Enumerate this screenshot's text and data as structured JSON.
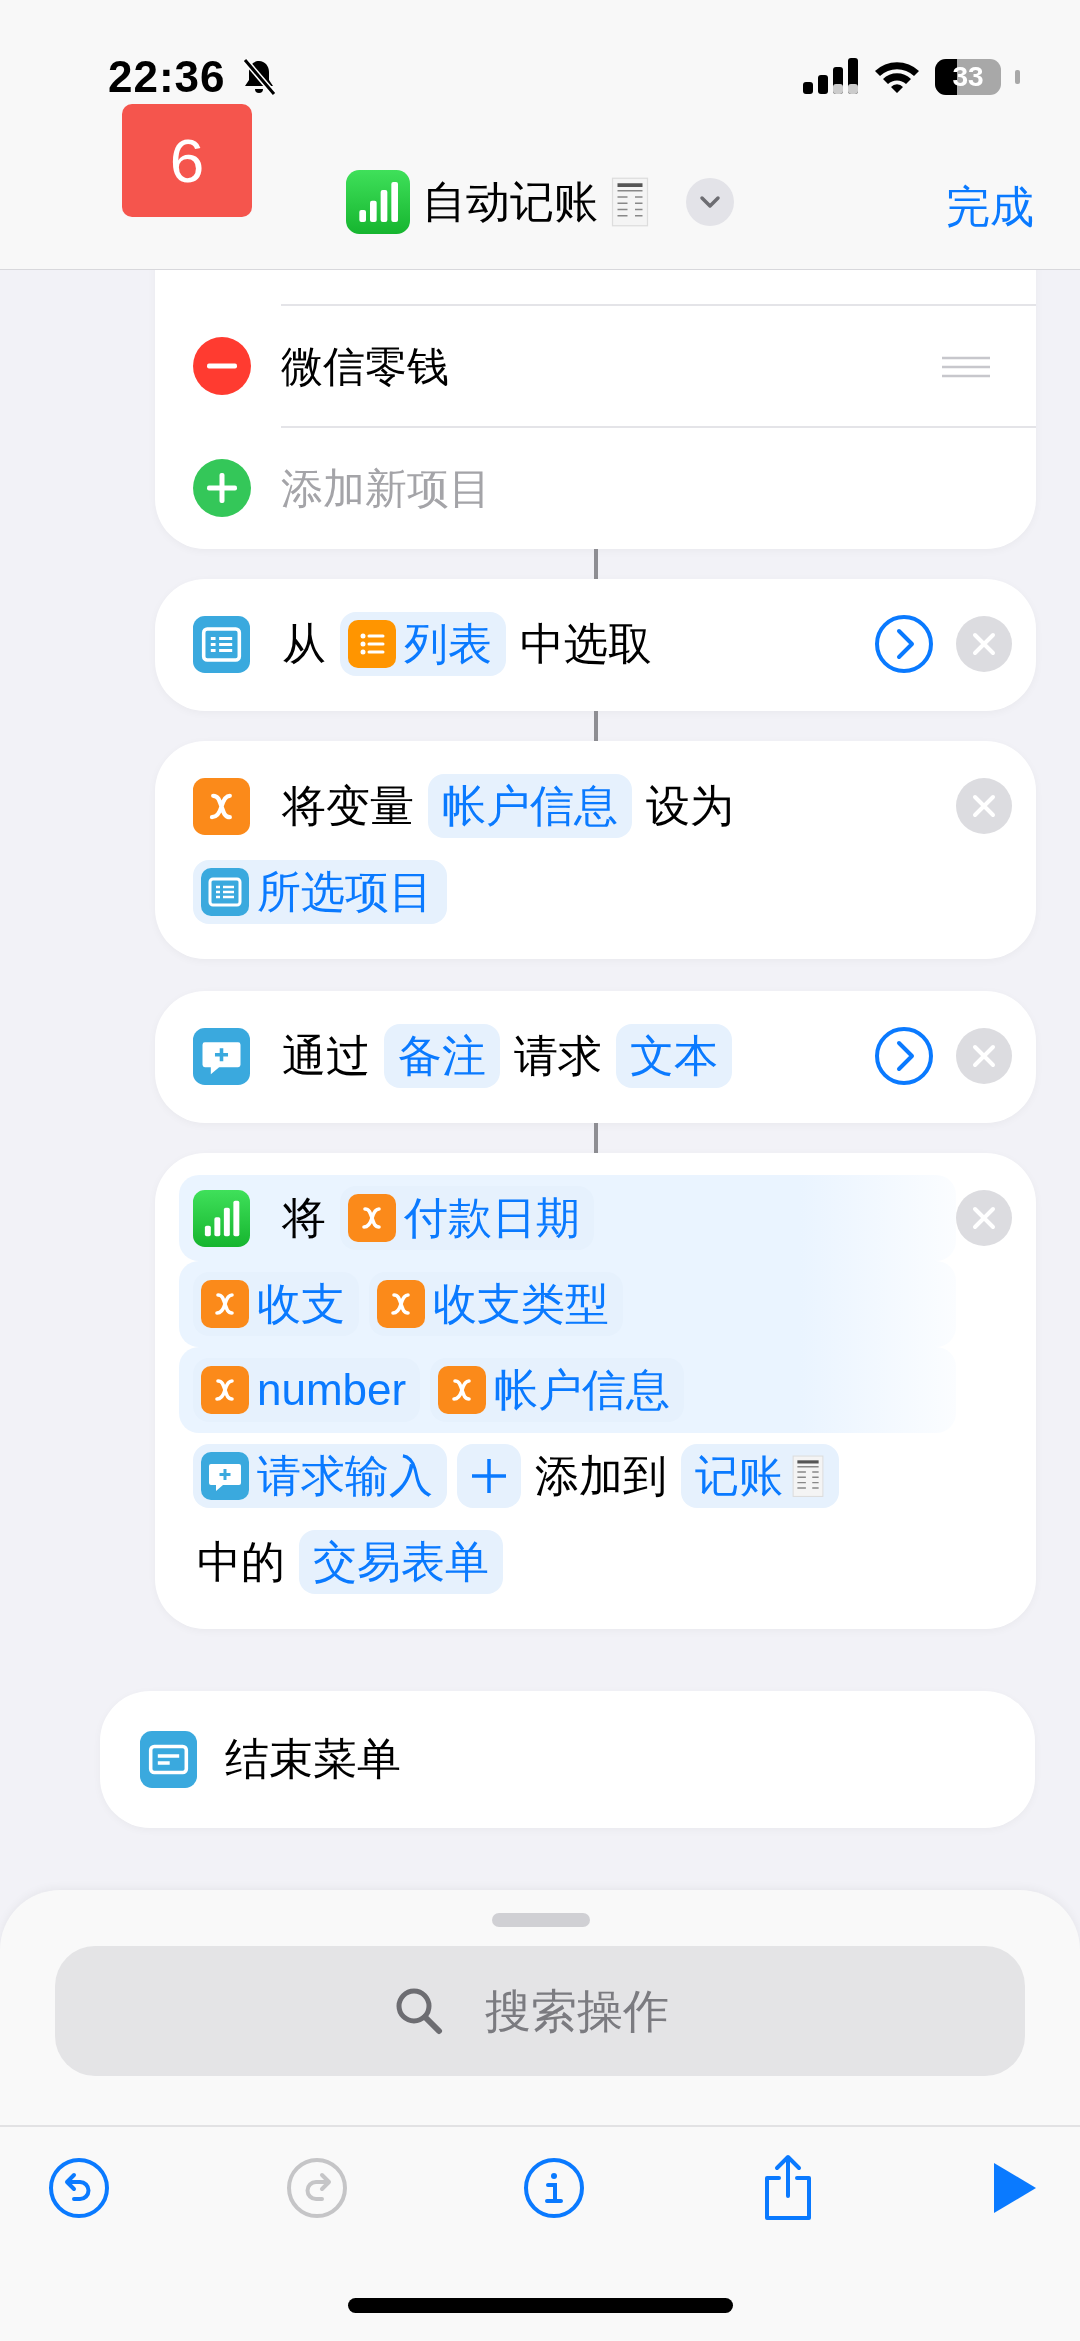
{
  "status_bar": {
    "time": "22:36",
    "battery": "33"
  },
  "badge": {
    "text": "6"
  },
  "header": {
    "title": "自动记账",
    "done": "完成"
  },
  "list_card": {
    "items": [
      {
        "kind": "remove",
        "label": "微信零钱"
      },
      {
        "kind": "add",
        "label": "添加新项目"
      }
    ]
  },
  "actions": [
    {
      "kind": "choose",
      "connected": true,
      "chevron": true,
      "removable": true,
      "lines": [
        {
          "highlighted": false,
          "tokens": [
            {
              "kind": "text",
              "text": "从"
            },
            {
              "kind": "list",
              "text": "列表"
            },
            {
              "kind": "text",
              "text": "中选取"
            }
          ]
        }
      ]
    },
    {
      "kind": "set-variable",
      "connected": true,
      "chevron": false,
      "removable": true,
      "lines": [
        {
          "highlighted": false,
          "tokens": [
            {
              "kind": "text",
              "text": "将变量"
            },
            {
              "kind": "chip",
              "text": "帐户信息"
            },
            {
              "kind": "text",
              "text": "设为"
            }
          ]
        },
        {
          "highlighted": false,
          "tokens": [
            {
              "kind": "selection",
              "text": "所选项目"
            }
          ]
        }
      ]
    },
    {
      "kind": "ask",
      "connected": false,
      "chevron": true,
      "removable": true,
      "lines": [
        {
          "highlighted": false,
          "tokens": [
            {
              "kind": "text",
              "text": "通过"
            },
            {
              "kind": "chip",
              "text": "备注"
            },
            {
              "kind": "text",
              "text": "请求"
            },
            {
              "kind": "chip",
              "text": "文本"
            }
          ]
        }
      ]
    },
    {
      "kind": "add-row",
      "connected": true,
      "chevron": false,
      "removable": true,
      "lines": [
        {
          "highlighted": true,
          "tokens": [
            {
              "kind": "text",
              "text": "将"
            },
            {
              "kind": "variable",
              "text": "付款日期"
            }
          ]
        },
        {
          "highlighted": true,
          "tokens": [
            {
              "kind": "variable",
              "text": "收支"
            },
            {
              "kind": "variable",
              "text": "收支类型"
            }
          ]
        },
        {
          "highlighted": true,
          "tokens": [
            {
              "kind": "variable",
              "text": "number"
            },
            {
              "kind": "variable",
              "text": "帐户信息"
            }
          ]
        },
        {
          "highlighted": false,
          "tokens": [
            {
              "kind": "input",
              "text": "请求输入"
            },
            {
              "kind": "plus"
            },
            {
              "kind": "text",
              "text": "添加到"
            },
            {
              "kind": "document",
              "text": "记账"
            }
          ]
        },
        {
          "highlighted": false,
          "tokens": [
            {
              "kind": "text",
              "text": "中的"
            },
            {
              "kind": "chip",
              "text": "交易表单"
            }
          ]
        }
      ]
    }
  ],
  "end_card": {
    "kind": "end-menu",
    "title": "结束菜单"
  },
  "search": {
    "placeholder": "搜索操作"
  },
  "toolbar": [
    {
      "kind": "undo",
      "disabled": false
    },
    {
      "kind": "redo",
      "disabled": true
    },
    {
      "kind": "info",
      "disabled": false
    },
    {
      "kind": "share",
      "disabled": false
    },
    {
      "kind": "run",
      "disabled": false
    }
  ]
}
